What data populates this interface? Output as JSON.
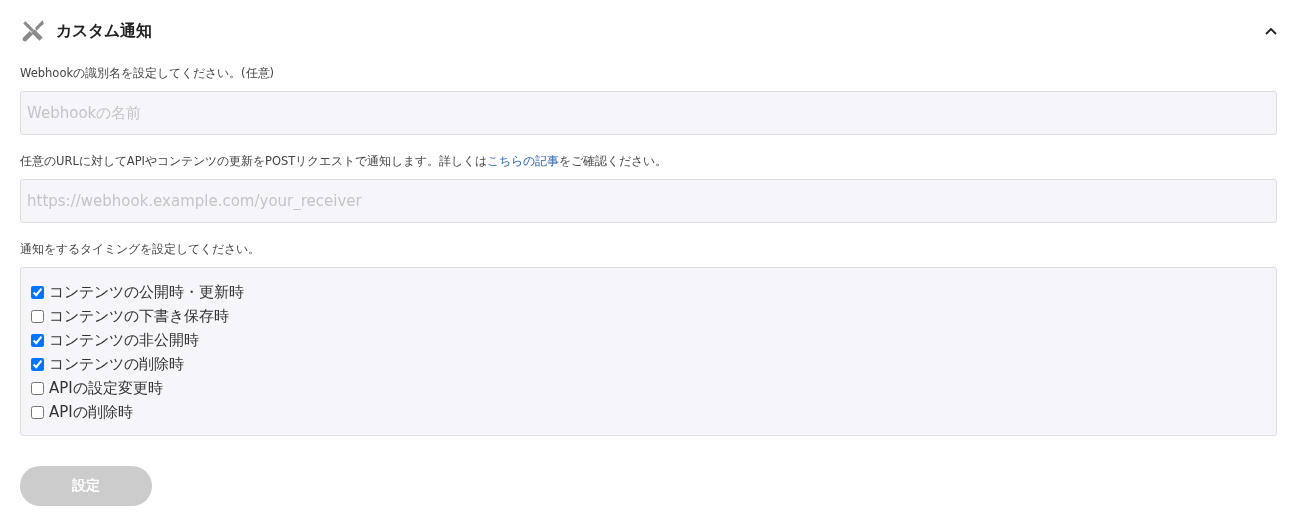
{
  "section": {
    "title": "カスタム通知",
    "expanded": true
  },
  "name_field": {
    "label": "Webhookの識別名を設定してください。(任意)",
    "placeholder": "Webhookの名前"
  },
  "url_field": {
    "label_before": "任意のURLに対してAPIやコンテンツの更新をPOSTリクエストで通知します。詳しくは",
    "label_link": "こちらの記事",
    "label_after": "をご確認ください。",
    "placeholder": "https://webhook.example.com/your_receiver"
  },
  "timing": {
    "label": "通知をするタイミングを設定してください。",
    "options": [
      {
        "label": "コンテンツの公開時・更新時",
        "checked": true
      },
      {
        "label": "コンテンツの下書き保存時",
        "checked": false
      },
      {
        "label": "コンテンツの非公開時",
        "checked": true
      },
      {
        "label": "コンテンツの削除時",
        "checked": true
      },
      {
        "label": "APIの設定変更時",
        "checked": false
      },
      {
        "label": "APIの削除時",
        "checked": false
      }
    ]
  },
  "submit": {
    "label": "設定",
    "disabled": true
  }
}
